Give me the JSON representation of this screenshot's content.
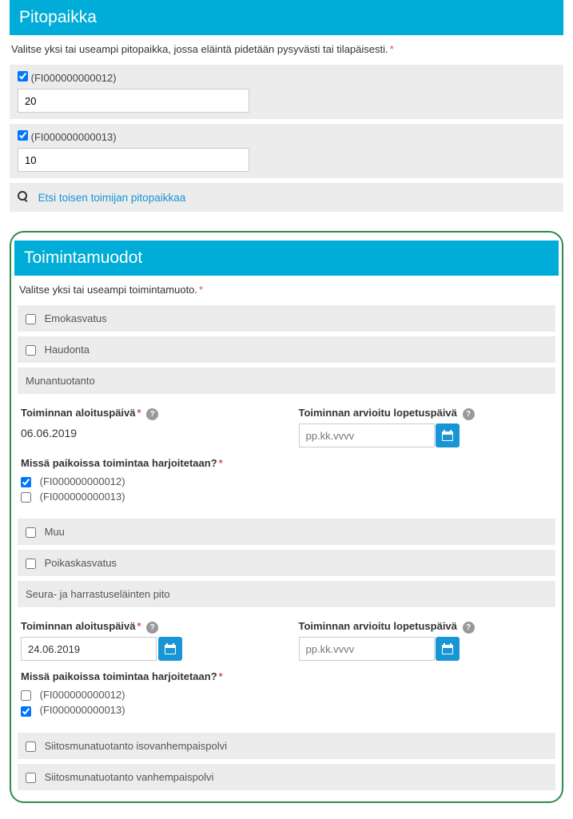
{
  "pitopaikka": {
    "title": "Pitopaikka",
    "instruction": "Valitse yksi tai useampi pitopaikka, jossa eläintä pidetään pysyvästi tai tilapäisesti.",
    "items": [
      {
        "code": "(FI000000000012)",
        "value": "20"
      },
      {
        "code": "(FI000000000013)",
        "value": "10"
      }
    ],
    "search_link": "Etsi toisen toimijan pitopaikkaa"
  },
  "toimintamuodot": {
    "title": "Toimintamuodot",
    "instruction": "Valitse yksi tai useampi toimintamuoto.",
    "start_label": "Toiminnan aloituspäivä",
    "end_label": "Toiminnan arvioitu lopetuspäivä",
    "date_placeholder": "pp.kk.vvvv",
    "location_question": "Missä paikoissa toimintaa harjoitetaan?",
    "opt_emokasvatus": "Emokasvatus",
    "opt_haudonta": "Haudonta",
    "munantuotanto": {
      "label": "Munantuotanto",
      "start_date": "06.06.2019",
      "loc1": "(FI000000000012)",
      "loc2": "(FI000000000013)"
    },
    "opt_muu": "Muu",
    "opt_poikaskasvatus": "Poikaskasvatus",
    "seura": {
      "label": "Seura- ja harrastuseläinten pito",
      "start_date": "24.06.2019",
      "loc1": "(FI000000000012)",
      "loc2": "(FI000000000013)"
    },
    "opt_siitos_iso": "Siitosmunatuotanto isovanhempaispolvi",
    "opt_siitos_van": "Siitosmunatuotanto vanhempaispolvi"
  }
}
